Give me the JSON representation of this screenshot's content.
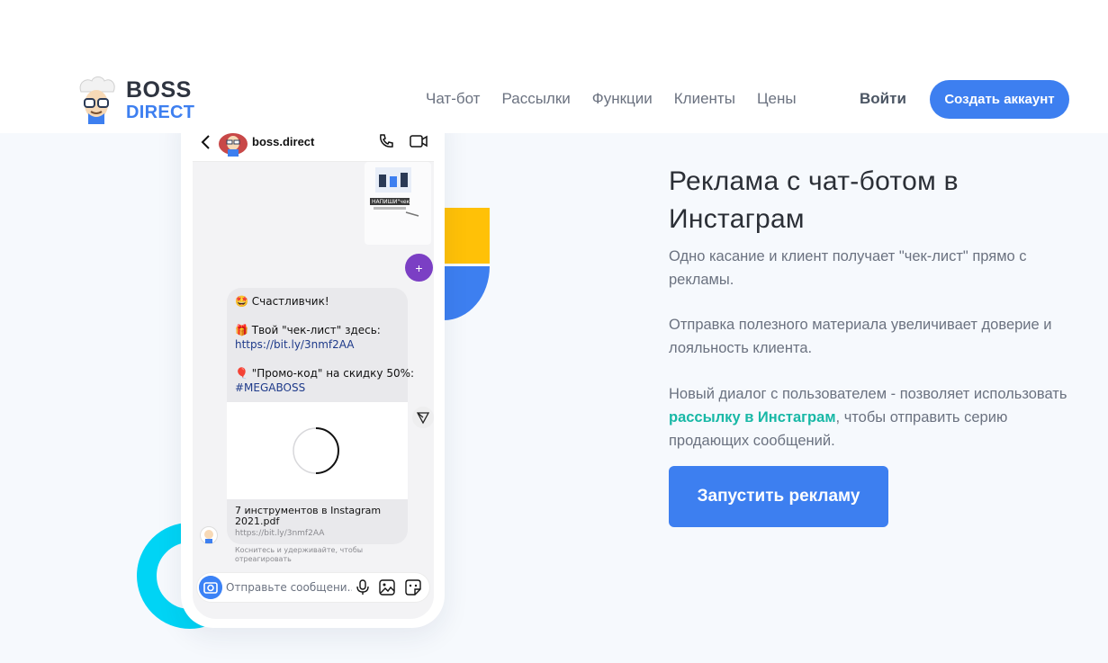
{
  "colors": {
    "accent": "#3d7ff0",
    "highlight_link": "#18b8a6",
    "shape_yellow": "#ffc107",
    "shape_cyan": "#00d4f5",
    "plus_button": "#7b3fc4"
  },
  "header": {
    "logo": {
      "line1": "BOSS",
      "line2": "DIRECT",
      "mascot_icon": "mascot-avatar-icon"
    },
    "nav": [
      "Чат-бот",
      "Рассылки",
      "Функции",
      "Клиенты",
      "Цены"
    ],
    "login_label": "Войти",
    "signup_label": "Создать аккаунт"
  },
  "phone": {
    "chat_name": "boss.direct",
    "image_card_caption": "НАПИШИ\"чек",
    "plus_label": "+",
    "message": {
      "greeting": "🤩 Счастливчик!",
      "checklist_label": "🎁 Твой \"чек-лист\" здесь:",
      "checklist_link": "https://bit.ly/3nmf2AA",
      "promo_label": "🎈 \"Промо-код\" на скидку 50%:",
      "promo_code": "#MEGABOSS"
    },
    "attachment": {
      "title": "7 инструментов в Instagram 2021.pdf",
      "link": "https://bit.ly/3nmf2AA"
    },
    "hint": "Коснитесь и удерживайте, чтобы отреагировать",
    "input_placeholder": "Отправьте сообщени..."
  },
  "hero": {
    "title": "Реклама с чат-ботом в Инстаграм",
    "p1": "Одно касание и клиент получает \"чек-лист\" прямо с рекламы.",
    "p2": "Отправка полезного материала увеличивает доверие и лояльность клиента.",
    "p3_before": "Новый диалог с пользователем - позволяет использовать ",
    "p3_link": "рассылку в Инстаграм",
    "p3_after": ", чтобы отправить серию продающих сообщений.",
    "cta_label": "Запустить рекламу"
  }
}
